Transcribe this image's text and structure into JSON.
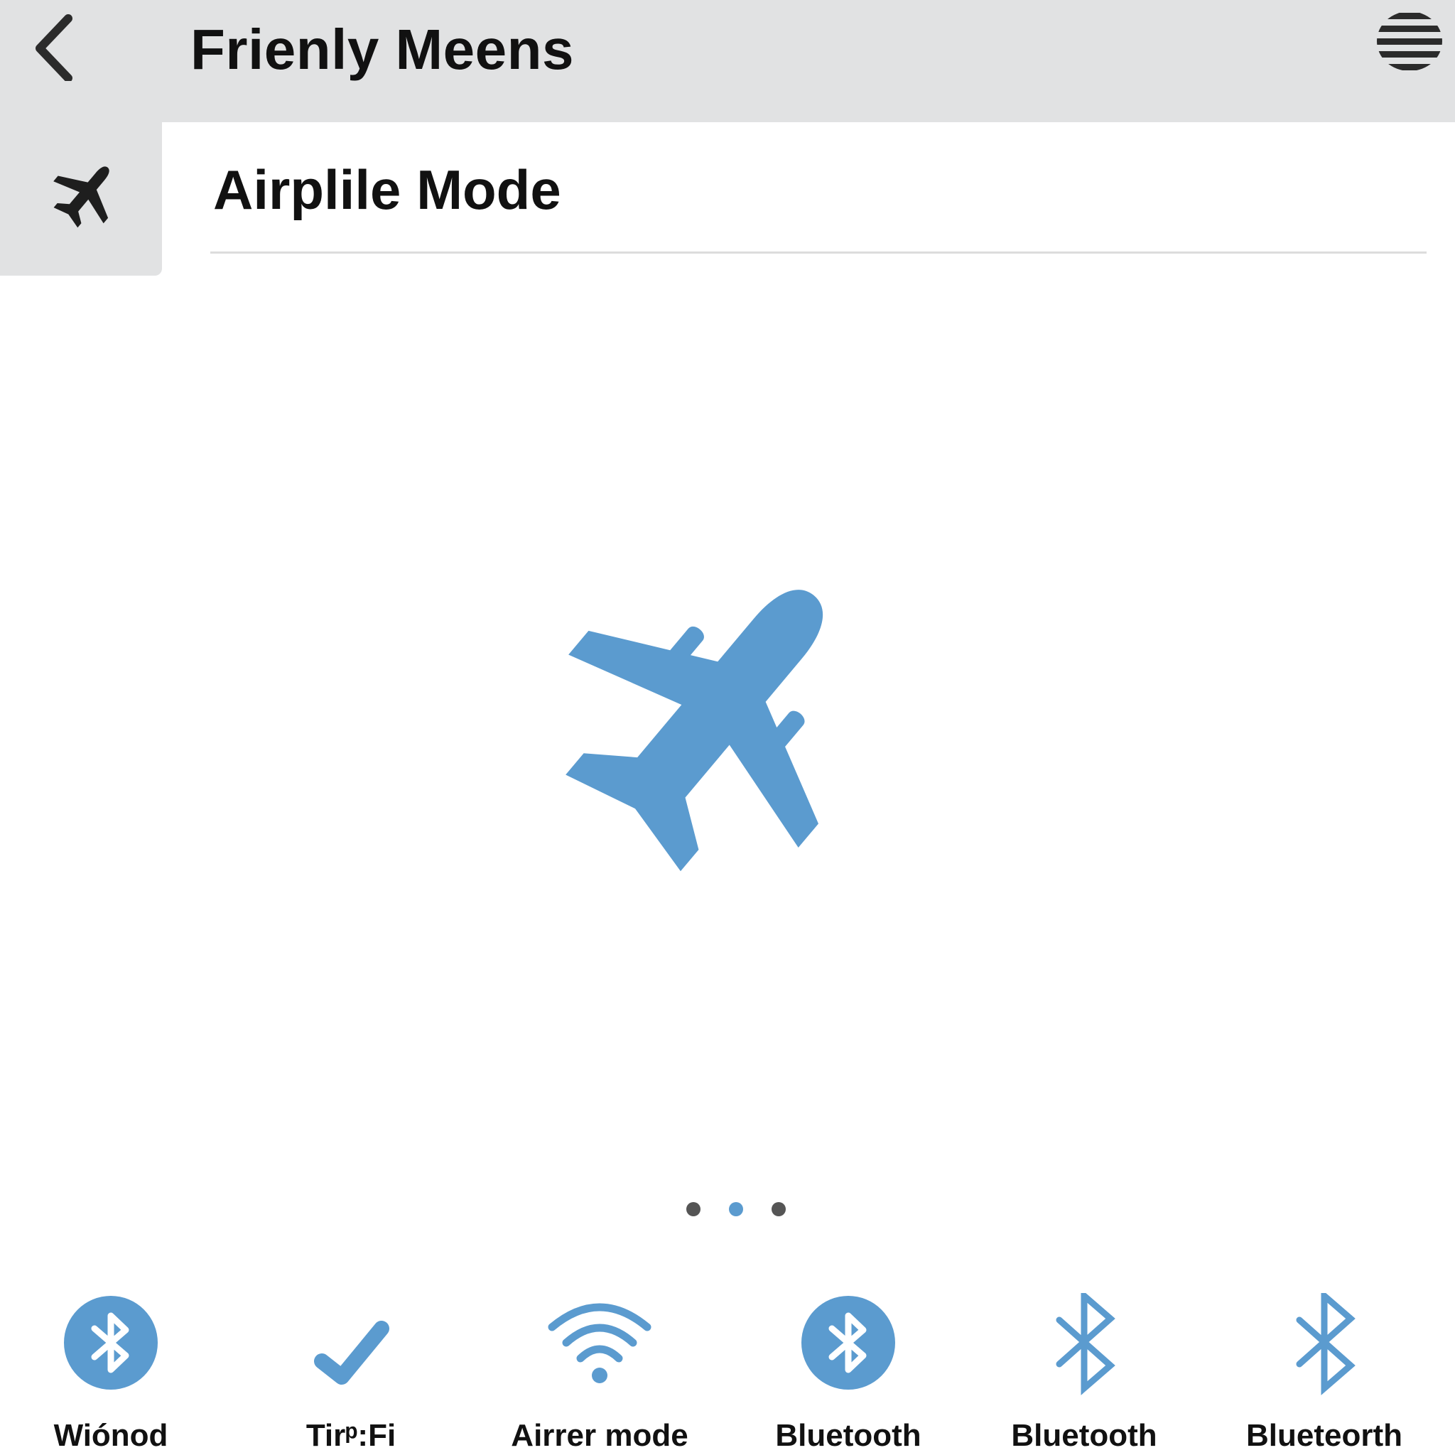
{
  "header": {
    "title": "Frienly Meens",
    "back_icon": "chevron-left-icon",
    "menu_icon": "hamburger-menu-icon"
  },
  "side_tab": {
    "icon": "airplane-icon"
  },
  "section": {
    "title": "Airplile Mode"
  },
  "hero": {
    "icon": "airplane-icon",
    "color": "#5b9bcf"
  },
  "pager": {
    "count": 3,
    "active_index": 1,
    "active_color": "#5b9bcf",
    "inactive_color": "#555555"
  },
  "toggles": [
    {
      "label": "Wiónod",
      "icon": "bluetooth-circle-icon"
    },
    {
      "label": "Tirᵖ:Fi",
      "icon": "checkmark-icon"
    },
    {
      "label": "Airrer mode",
      "icon": "wifi-icon"
    },
    {
      "label": "Bluetooth",
      "icon": "bluetooth-circle-icon"
    },
    {
      "label": "Bluetooth",
      "icon": "bluetooth-icon"
    },
    {
      "label": "Blueteorth",
      "icon": "bluetooth-icon"
    }
  ],
  "colors": {
    "accent": "#5b9bcf",
    "header_bg": "#e1e2e3",
    "text": "#111111"
  }
}
